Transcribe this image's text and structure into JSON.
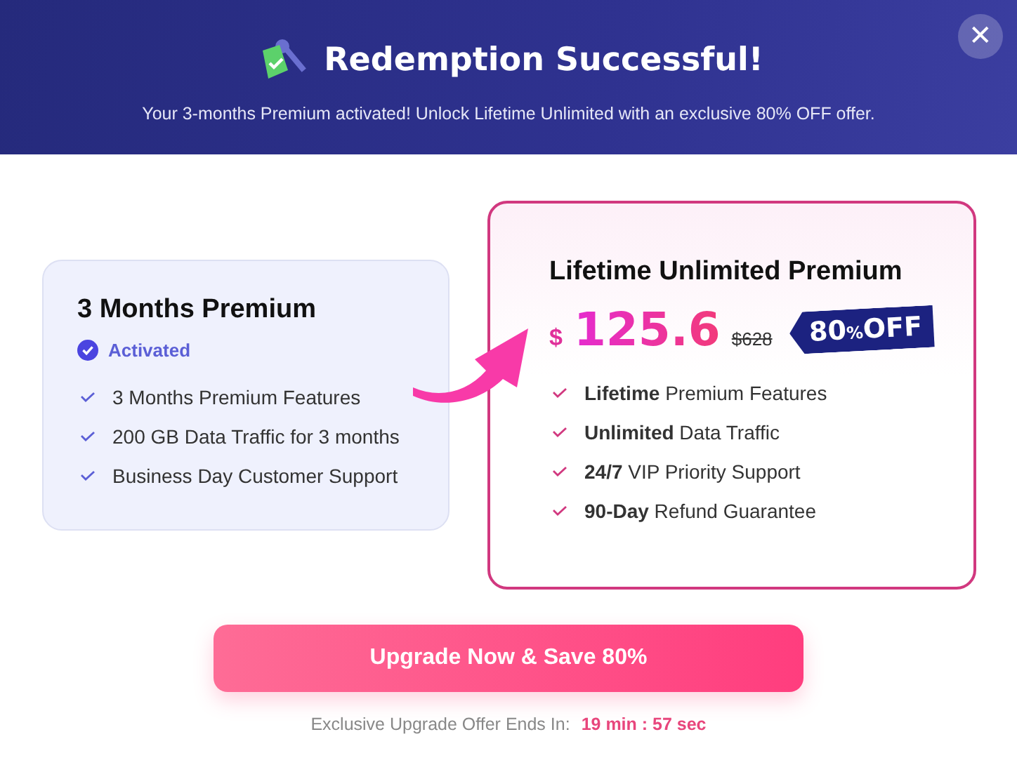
{
  "header": {
    "title": "Redemption Successful!",
    "subtitle": "Your 3-months Premium activated! Unlock Lifetime Unlimited with an exclusive 80% OFF offer.",
    "close": "✕"
  },
  "current_plan": {
    "title": "3 Months Premium",
    "status": "Activated",
    "features": [
      "3 Months Premium Features",
      "200 GB Data Traffic for 3 months",
      "Business Day Customer Support"
    ]
  },
  "offer_plan": {
    "title": "Lifetime Unlimited Premium",
    "currency": "$",
    "price": "125.6",
    "old_price": "$628",
    "badge": {
      "value": "80",
      "unit": "%",
      "label": "OFF"
    },
    "features": [
      "**Lifetime** Premium Features",
      "**Unlimited** Data Traffic",
      "**24/7** VIP Priority Support",
      "**90-Day** Refund Guarantee"
    ]
  },
  "upgrade_button": "Upgrade Now & Save 80%",
  "timer": {
    "label": "Exclusive Upgrade Offer Ends In:",
    "value": "19 min : 57 sec"
  }
}
